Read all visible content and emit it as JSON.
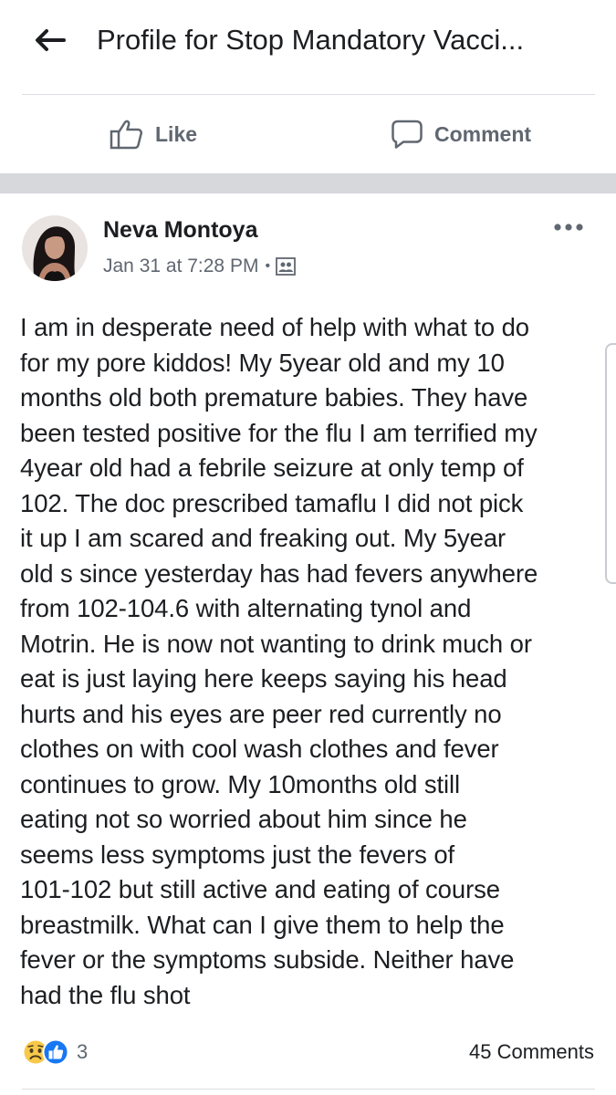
{
  "header": {
    "title": "Profile for Stop Mandatory Vacci...",
    "back_icon": "back-arrow-icon"
  },
  "actions": {
    "like_label": "Like",
    "comment_label": "Comment"
  },
  "post": {
    "author": "Neva Montoya",
    "timestamp": "Jan 31 at 7:28 PM",
    "separator": "•",
    "privacy_icon": "friends-icon",
    "more_icon": "more-dots-icon",
    "lines": [
      "I am in desperate need of help with what to do",
      "for my pore kiddos! My 5year old and my 10",
      "months old both premature babies. They have",
      "been tested positive for the flu I am terrified my",
      "4year old had a febrile seizure at only temp of",
      "102. The doc prescribed tamaflu I did not pick",
      "it up I am scared and freaking out. My 5year",
      "old s since yesterday has had fevers anywhere",
      "from 102-104.6 with alternating tynol and",
      "Motrin. He is now not wanting to drink much or",
      "eat is just laying here keeps saying his head",
      "hurts and his eyes are peer red currently no",
      "clothes on with cool wash clothes and fever",
      "continues to grow. My 10months old still",
      "eating not so worried about him since he",
      "seems less symptoms just the fevers of",
      "101-102 but still active and eating of course",
      "breastmilk. What can I give them to help the",
      "fever or the symptoms subside. Neither have",
      "had the flu shot"
    ]
  },
  "footer": {
    "reaction_icons": [
      "sad-reaction-icon",
      "like-reaction-icon"
    ],
    "reaction_count": "3",
    "comments_count": "45 Comments"
  },
  "colors": {
    "text": "#1c1e21",
    "muted": "#606770",
    "separator_band": "#d6d8dc",
    "like_blue": "#1877f2",
    "sad_yellow": "#f7c94a"
  }
}
